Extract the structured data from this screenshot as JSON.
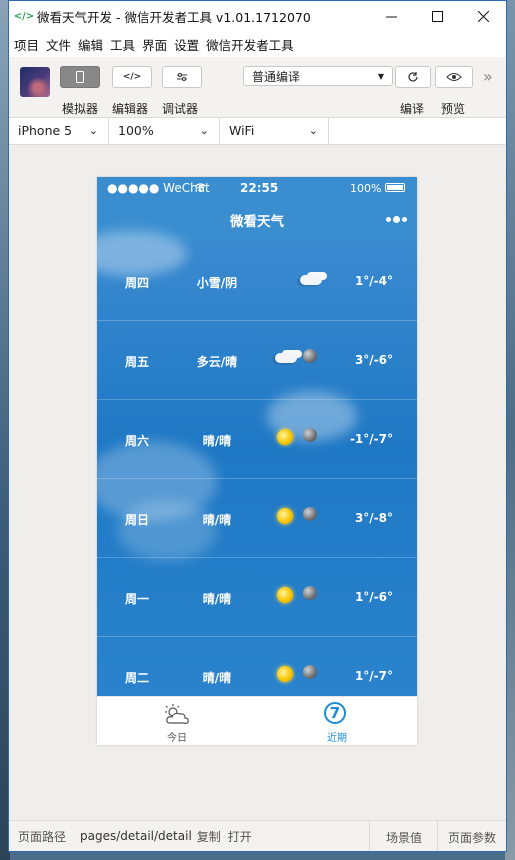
{
  "window": {
    "title": "微看天气开发 - 微信开发者工具 v1.01.1712070",
    "icon": "</>",
    "controls": [
      "minimize-icon",
      "maximize-icon",
      "close-icon"
    ]
  },
  "menu": [
    "项目",
    "文件",
    "编辑",
    "工具",
    "界面",
    "设置",
    "微信开发者工具"
  ],
  "toolbar": {
    "simulator_label": "模拟器",
    "editor_label": "编辑器",
    "debugger_label": "调试器",
    "compile_mode": "普通编译",
    "compile_label": "编译",
    "preview_label": "预览"
  },
  "device": {
    "model": "iPhone 5",
    "zoom": "100%",
    "network": "WiFi"
  },
  "phone": {
    "carrier": "●●●●● WeChat",
    "time": "22:55",
    "battery": "100%",
    "nav_title": "微看天气",
    "days": [
      {
        "day": "周四",
        "cond": "小雪/阴",
        "temp": "1°/-4°",
        "icons": [
          "cloud-icon"
        ]
      },
      {
        "day": "周五",
        "cond": "多云/晴",
        "temp": "3°/-6°",
        "icons": [
          "cloud-icon",
          "moon-icon"
        ]
      },
      {
        "day": "周六",
        "cond": "晴/晴",
        "temp": "-1°/-7°",
        "icons": [
          "sun-icon",
          "moon-icon"
        ]
      },
      {
        "day": "周日",
        "cond": "晴/晴",
        "temp": "3°/-8°",
        "icons": [
          "sun-icon",
          "moon-icon"
        ]
      },
      {
        "day": "周一",
        "cond": "晴/晴",
        "temp": "1°/-6°",
        "icons": [
          "sun-icon",
          "moon-icon"
        ]
      },
      {
        "day": "周二",
        "cond": "晴/晴",
        "temp": "1°/-7°",
        "icons": [
          "sun-icon",
          "moon-icon"
        ]
      }
    ],
    "tabs": [
      {
        "label": "今日",
        "icon": "cloud-sun-icon",
        "color": "#555555"
      },
      {
        "label": "近期",
        "icon": "seven-day-icon",
        "color": "#1a8cd8"
      }
    ],
    "seven_glyph": "7"
  },
  "status": {
    "path_label": "页面路径",
    "path": "pages/detail/detail",
    "copy": "复制",
    "open": "打开",
    "scene": "场景值",
    "params": "页面参数"
  },
  "colors": {
    "nav_blue": "#3a8ed0",
    "accent_tab": "#1a8cd8"
  }
}
